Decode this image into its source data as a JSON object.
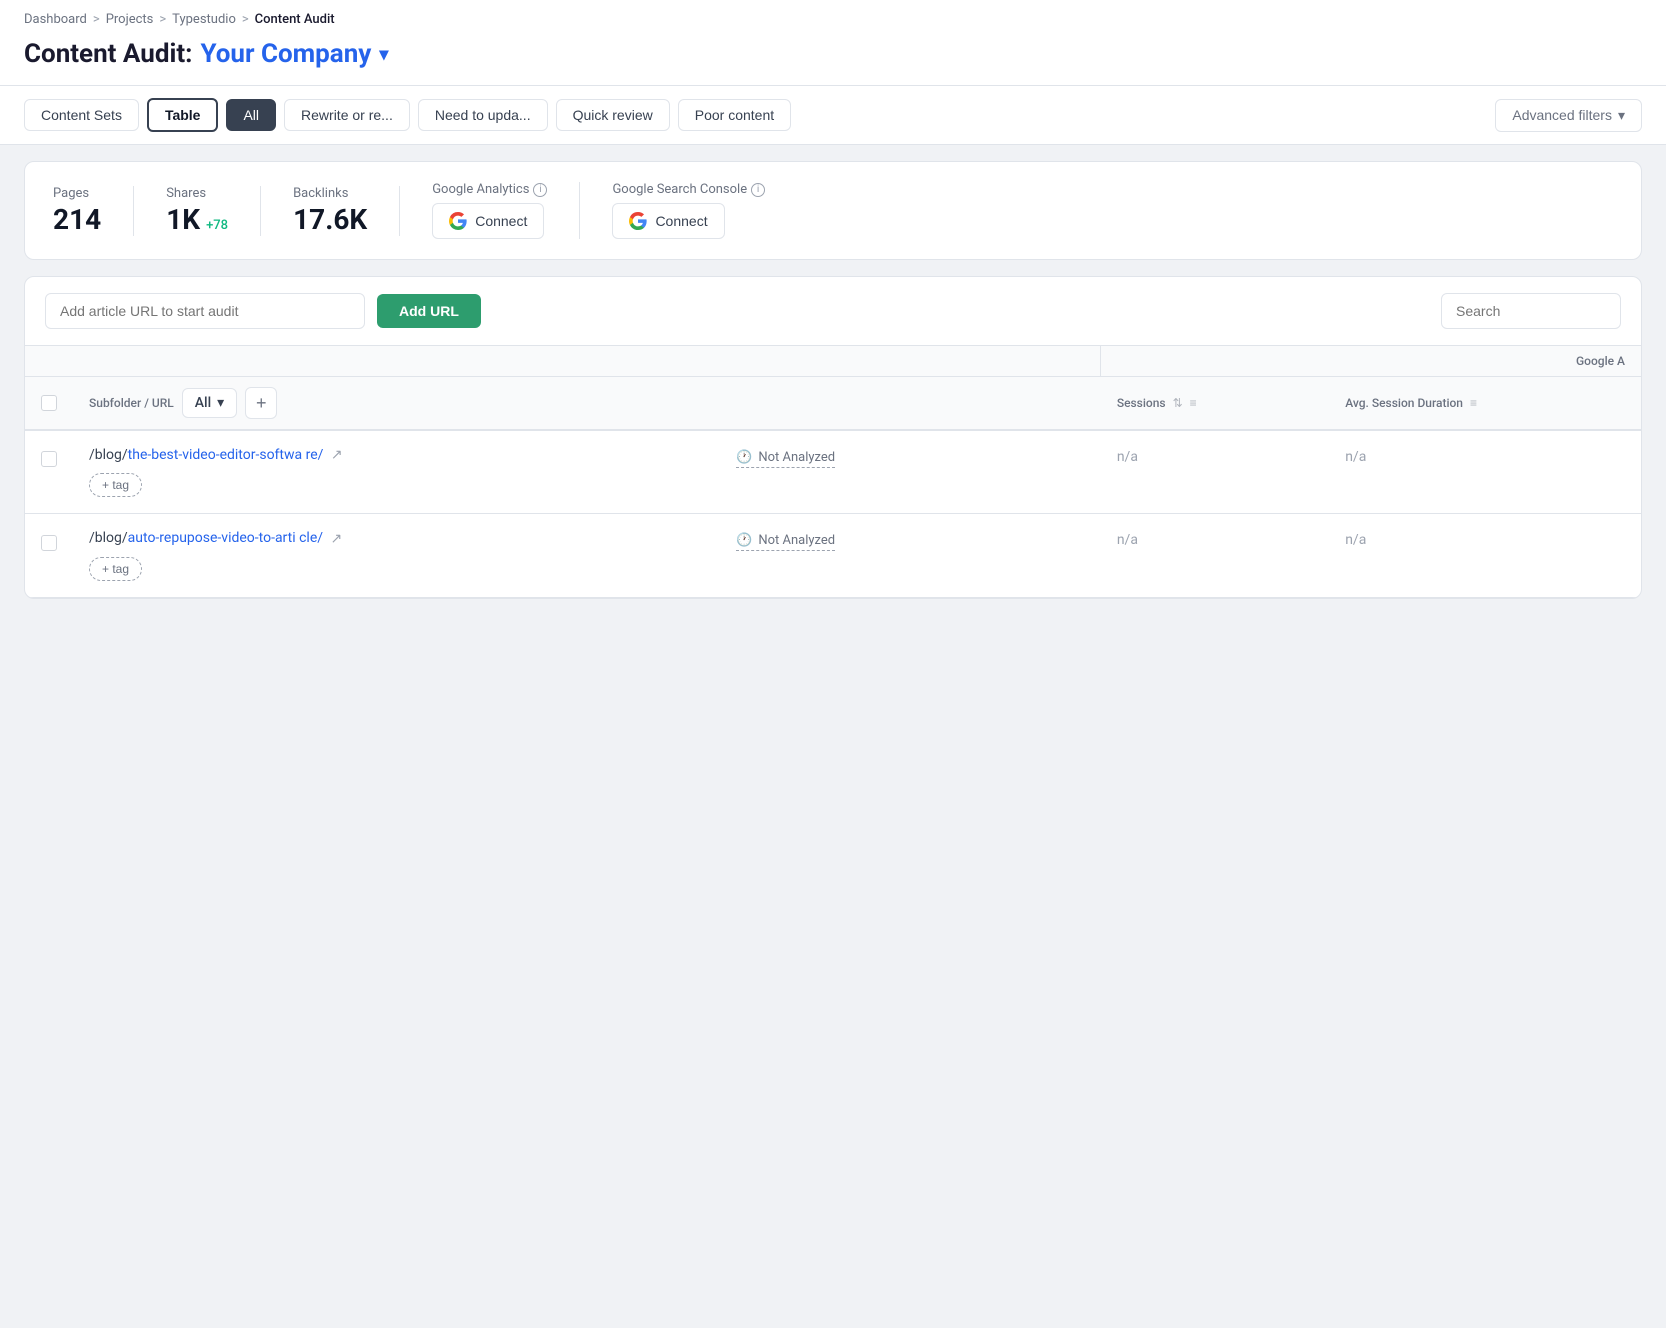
{
  "breadcrumb": {
    "items": [
      "Dashboard",
      "Projects",
      "Typestudio",
      "Content Audit"
    ],
    "separators": [
      ">",
      ">",
      ">"
    ]
  },
  "page": {
    "title": "Content Audit:",
    "company": "Your Company",
    "chevron": "▾"
  },
  "nav": {
    "tabs": [
      {
        "id": "content-sets",
        "label": "Content Sets",
        "active": false
      },
      {
        "id": "table",
        "label": "Table",
        "active": true
      },
      {
        "id": "all",
        "label": "All",
        "active": true,
        "pill": true
      },
      {
        "id": "rewrite",
        "label": "Rewrite or re...",
        "active": false
      },
      {
        "id": "need-update",
        "label": "Need to upda...",
        "active": false
      },
      {
        "id": "quick-review",
        "label": "Quick review",
        "active": false
      },
      {
        "id": "poor-content",
        "label": "Poor content",
        "active": false
      }
    ],
    "advanced_filters": "Advanced filters"
  },
  "stats": {
    "pages": {
      "label": "Pages",
      "value": "214"
    },
    "shares": {
      "label": "Shares",
      "value": "1K",
      "delta": "+78"
    },
    "backlinks": {
      "label": "Backlinks",
      "value": "17.6K"
    },
    "google_analytics": {
      "label": "Google Analytics",
      "connect_label": "Connect"
    },
    "google_search_console": {
      "label": "Google Search Console",
      "connect_label": "Connect"
    }
  },
  "toolbar": {
    "url_placeholder": "Add article URL to start audit",
    "add_url_label": "Add URL",
    "search_placeholder": "Search"
  },
  "table": {
    "columns": {
      "subfolder_url": "Subfolder / URL",
      "all_dropdown": "All",
      "google_analytics_group": "Google A",
      "sessions": "Sessions",
      "avg_session_duration": "Avg. Session Duration"
    },
    "rows": [
      {
        "url_prefix": "/blog/",
        "url_link": "the-best-video-editor-softwa re/",
        "url_full": "/blog/the-best-video-editor-software/",
        "status": "Not Analyzed",
        "sessions": "n/a",
        "avg_session": "n/a",
        "tag_label": "+ tag"
      },
      {
        "url_prefix": "/blog/",
        "url_link": "auto-repupose-video-to-arti cle/",
        "url_full": "/blog/auto-repupose-video-to-article/",
        "status": "Not Analyzed",
        "sessions": "n/a",
        "avg_session": "n/a",
        "tag_label": "+ tag"
      }
    ]
  },
  "icons": {
    "chevron_down": "▾",
    "external_link": "↗",
    "clock": "🕐",
    "info": "i",
    "sort": "⇅",
    "filter": "≡",
    "plus": "+"
  }
}
